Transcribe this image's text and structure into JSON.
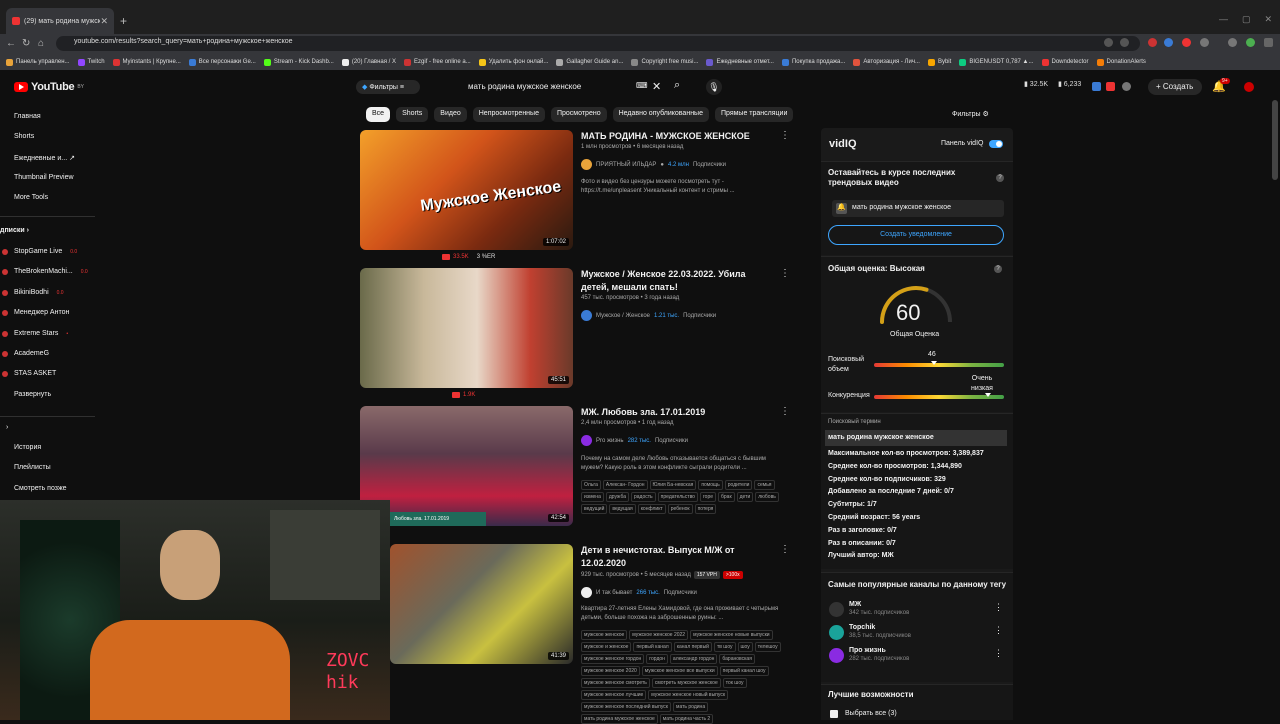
{
  "browser": {
    "tab_title": "(29) мать родина мужское жен",
    "url": "youtube.com/results?search_query=мать+родина+мужское+женское",
    "bookmarks": [
      {
        "label": "Панель управлен...",
        "color": "#e8a33a"
      },
      {
        "label": "Twitch",
        "color": "#9146ff"
      },
      {
        "label": "Myinstants | Крупне...",
        "color": "#d33"
      },
      {
        "label": "Все персонажи Ge...",
        "color": "#3a7bd5"
      },
      {
        "label": "Stream - Kick Dashb...",
        "color": "#53fc18"
      },
      {
        "label": "(20) Главная / X",
        "color": "#eee"
      },
      {
        "label": "Ezgif - free online a...",
        "color": "#c33"
      },
      {
        "label": "Удалить фон онлай...",
        "color": "#f5c518"
      },
      {
        "label": "Gallagher Guide an...",
        "color": "#aaa"
      },
      {
        "label": "Copyright free musi...",
        "color": "#888"
      },
      {
        "label": "Ежедневные отмет...",
        "color": "#6a5acd"
      },
      {
        "label": "Покупка продажа...",
        "color": "#3a7bd5"
      },
      {
        "label": "Авторизация - Лич...",
        "color": "#e0533d"
      },
      {
        "label": "Bybit",
        "color": "#f7a600"
      },
      {
        "label": "BIGENUSDT 0,787 ▲...",
        "color": "#0ecb81"
      },
      {
        "label": "Downdetector",
        "color": "#e33"
      },
      {
        "label": "DonationAlerts",
        "color": "#f57d07"
      }
    ]
  },
  "header": {
    "logo": "YouTube",
    "logo_region": "BY",
    "filters_btn": "Фильтры",
    "search_value": "мать родина мужское женское",
    "stat1": "32.5K",
    "stat2": "6,233",
    "create": "Создать",
    "notif_count": "9+"
  },
  "sidebar": {
    "items": [
      {
        "label": "Главная"
      },
      {
        "label": "Shorts"
      },
      {
        "label": "Ежедневные и..."
      },
      {
        "label": "Thumbnail Preview"
      },
      {
        "label": "More Tools"
      }
    ],
    "subs_title": "дписки",
    "subs": [
      {
        "label": "StopGame Live",
        "badge": "0.0"
      },
      {
        "label": "TheBrokenMachi...",
        "badge": "0.0"
      },
      {
        "label": "BikiniBodhi",
        "badge": "0.0"
      },
      {
        "label": "Менеджер Антон",
        "badge": ""
      },
      {
        "label": "Extreme Stars",
        "badge": "•"
      },
      {
        "label": "AcademeG",
        "badge": ""
      },
      {
        "label": "STAS ASKET",
        "badge": ""
      },
      {
        "label": "Развернуть",
        "badge": ""
      }
    ],
    "you_items": [
      {
        "label": "История"
      },
      {
        "label": "Плейлисты"
      },
      {
        "label": "Смотреть позже"
      }
    ]
  },
  "chips": [
    "Все",
    "Shorts",
    "Видео",
    "Непросмотренные",
    "Просмотрено",
    "Недавно опубликованные",
    "Прямые трансляции"
  ],
  "filters_right": "Фильтры",
  "videos": [
    {
      "title": "МАТЬ РОДИНА - МУЖСКОЕ ЖЕНСКОЕ",
      "meta": "1 млн просмотров • 6 месяцев назад",
      "channel": "ПРИЯТНЫЙ ИЛЬДАР",
      "subs": "4.2 млн",
      "subs_suffix": "Подписчики",
      "desc": "Фото и видео без цензуры можете посмотреть тут - https://t.me/unpleasent Уникальный контент и стримы ...",
      "duration": "1:07:02",
      "stat_views": "33.5K",
      "stat_er": "3 %ER",
      "thumb_text": "Мужское Женское"
    },
    {
      "title": "Мужское / Женское 22.03.2022. Убила детей, мешали спать!",
      "meta": "457 тыс. просмотров • 3 года назад",
      "channel": "Мужское / Женское",
      "subs": "1.21 тыс.",
      "subs_suffix": "Подписчики",
      "duration": "45:51",
      "stat_views": "1.9K"
    },
    {
      "title": "МЖ. Любовь зла. 17.01.2019",
      "meta": "2,4 млн просмотров • 1 год назад",
      "channel": "Pro жизнь",
      "subs": "282 тыс.",
      "subs_suffix": "Подписчики",
      "desc": "Почему на самом деле Любовь отказывается общаться с бывшим мужем? Какую роль в этом конфликте сыграли родители ...",
      "duration": "42:54",
      "thumb_caption": "Любовь зла. 17.01.2019",
      "tags": [
        "Ольга",
        "Алексан- Гордон",
        "Юлия Ба-невская",
        "помощь",
        "родители",
        "семья",
        "измена",
        "дружба",
        "радость",
        "предательство",
        "горе",
        "брак",
        "дети",
        "любовь",
        "ведущий",
        "ведущая",
        "конфликт",
        "ребенок",
        "потеря"
      ]
    },
    {
      "title": "Дети в нечистотах. Выпуск М/Ж от 12.02.2020",
      "meta": "929 тыс. просмотров • 5 месяцев назад",
      "vph": "157 VPH",
      "x100": ">100x",
      "channel": "И так бывает",
      "subs": "266 тыс.",
      "subs_suffix": "Подписчики",
      "desc": "Квартира 27-летняя Елены Хамидовой, где она проживает с четырьмя детьми, больше похожа на заброшенные руины: ...",
      "duration": "41:39",
      "tags": [
        "мужское женское",
        "мужское женское 2022",
        "мужское женское новые выпуски",
        "мужское и женское",
        "первый канал",
        "канал первый",
        "тв шоу",
        "шоу",
        "телешоу",
        "мужское женское гордон",
        "гордон",
        "александр гордон",
        "барановская",
        "мужское женское 2020",
        "мужское женское все выпуски",
        "первый канал шоу",
        "мужское женское смотреть",
        "смотреть мужское женское",
        "ток шоу",
        "мужское женское лучшие",
        "мужское женское новый выпуск",
        "мужское женское последний выпуск",
        "мать родина",
        "мать родина мужское женское",
        "мать родина часть 2"
      ]
    }
  ],
  "vidiq": {
    "logo": "vidIQ",
    "panel_label": "Панель vidIQ",
    "trend_title": "Оставайтесь в курсе последних трендовых видео",
    "term": "мать родина мужское женское",
    "notify_btn": "Создать уведомление",
    "overall_title": "Общая оценка: Высокая",
    "score": "60",
    "score_label": "Общая Оценка",
    "search_volume_label": "Поисковый объем",
    "search_volume": "46",
    "search_volume_pct": 0.46,
    "competition_label": "Конкуренция",
    "competition_value": "Очень низкая",
    "competition_pct": 0.88,
    "search_term_label": "Поисковый термин",
    "search_term": "мать родина мужское женское",
    "stats": [
      {
        "label": "Максимальное кол-во просмотров:",
        "value": "3,389,837"
      },
      {
        "label": "Среднее кол-во просмотров:",
        "value": "1,344,890"
      },
      {
        "label": "Среднее кол-во подписчиков:",
        "value": "329"
      },
      {
        "label": "Добавлено за последние 7 дней:",
        "value": "0/7"
      },
      {
        "label": "Субтитры:",
        "value": "1/7"
      },
      {
        "label": "Средний возраст:",
        "value": "56 years"
      },
      {
        "label": "Раз в заголовке:",
        "value": "0/7"
      },
      {
        "label": "Раз в описании:",
        "value": "0/7"
      },
      {
        "label": "Лучший автор:",
        "value": "МЖ"
      }
    ],
    "channels_title": "Самые популярные каналы по данному тегу",
    "channels": [
      {
        "name": "МЖ",
        "subs": "342 тыс. подписчиков",
        "color": "#333"
      },
      {
        "name": "Topchik",
        "subs": "38,5 тыс. подписчиков",
        "color": "#1aa39a"
      },
      {
        "name": "Про жизнь",
        "subs": "282 тыс. подписчиков",
        "color": "#8a2be2"
      }
    ],
    "best_title": "Лучшие возможности",
    "select_all": "Выбрать все (3)"
  },
  "overlay_text": "ZOVC hik"
}
